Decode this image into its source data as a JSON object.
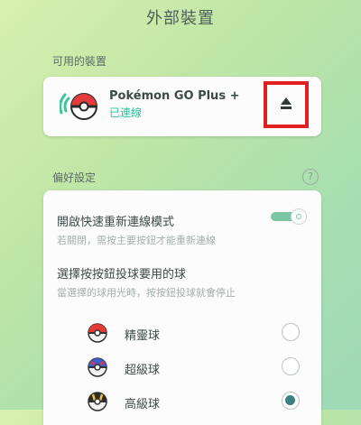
{
  "header": {
    "title": "外部裝置"
  },
  "available_devices": {
    "label": "可用的裝置",
    "device": {
      "name": "Pokémon GO Plus +",
      "status": "已連線"
    }
  },
  "preferences": {
    "label": "偏好設定",
    "help_icon": "?",
    "fast_reconnect": {
      "title": "開啟快速重新連線模式",
      "subtitle": "若關閉，需按主要按鈕才能重新連線",
      "enabled": true
    },
    "ball_choice": {
      "title": "選擇按按鈕投球要用的球",
      "subtitle": "當選擇的球用光時，按按鈕投球就會停止",
      "options": [
        {
          "label": "精靈球",
          "icon": "poke-ball-icon",
          "selected": false
        },
        {
          "label": "超級球",
          "icon": "great-ball-icon",
          "selected": false
        },
        {
          "label": "高級球",
          "icon": "ultra-ball-icon",
          "selected": true
        }
      ]
    }
  },
  "colors": {
    "accent": "#2cc09c",
    "highlight_box": "#e02020",
    "toggle_on": "#7dc6a4"
  }
}
